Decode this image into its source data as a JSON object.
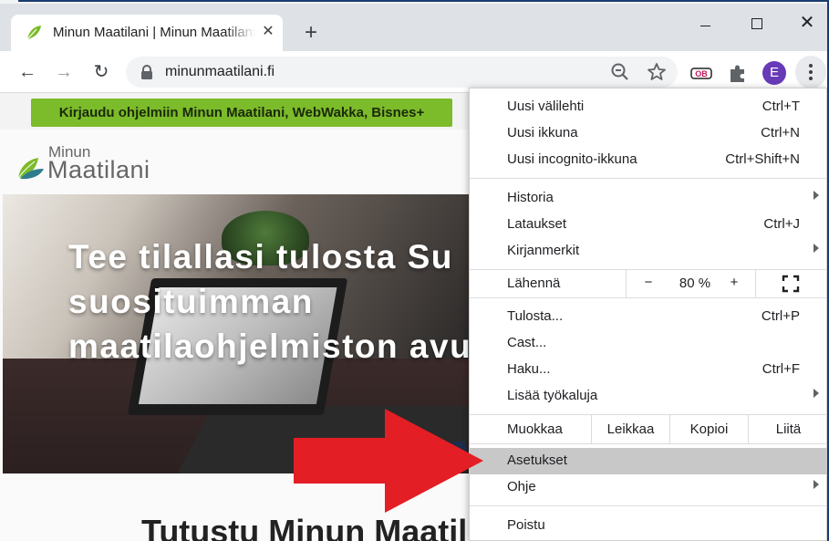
{
  "browser": {
    "tab": {
      "title": "Minun Maatilani | Minun Maatilani"
    },
    "url": "minunmaatilani.fi",
    "profile_initial": "E",
    "colors": {
      "profile": "#673ab7",
      "highlight": "#c8c8c8"
    }
  },
  "page": {
    "login_button": "Kirjaudu ohjelmiin Minun Maatilani, WebWakka, Bisnes+",
    "logo": {
      "small": "Minun",
      "big": "Maatilani"
    },
    "hero_lines": [
      "Tee tilallasi tulosta Su",
      "suosituimman",
      "maatilaohjelmiston avu"
    ],
    "section_title": "Tutustu Minun Maatil",
    "colors": {
      "login_button": "#7cbb2a",
      "arrow": "#e31e24"
    }
  },
  "menu": {
    "new_tab": {
      "label": "Uusi välilehti",
      "shortcut": "Ctrl+T"
    },
    "new_window": {
      "label": "Uusi ikkuna",
      "shortcut": "Ctrl+N"
    },
    "incognito": {
      "label": "Uusi incognito-ikkuna",
      "shortcut": "Ctrl+Shift+N"
    },
    "history": {
      "label": "Historia"
    },
    "downloads": {
      "label": "Lataukset",
      "shortcut": "Ctrl+J"
    },
    "bookmarks": {
      "label": "Kirjanmerkit"
    },
    "zoom": {
      "label": "Lähennä",
      "minus": "−",
      "value": "80 %",
      "plus": "+"
    },
    "print": {
      "label": "Tulosta...",
      "shortcut": "Ctrl+P"
    },
    "cast": {
      "label": "Cast..."
    },
    "find": {
      "label": "Haku...",
      "shortcut": "Ctrl+F"
    },
    "more_tools": {
      "label": "Lisää työkaluja"
    },
    "edit": {
      "label": "Muokkaa",
      "cut": "Leikkaa",
      "copy": "Kopioi",
      "paste": "Liitä"
    },
    "settings": {
      "label": "Asetukset"
    },
    "help": {
      "label": "Ohje"
    },
    "exit": {
      "label": "Poistu"
    }
  }
}
